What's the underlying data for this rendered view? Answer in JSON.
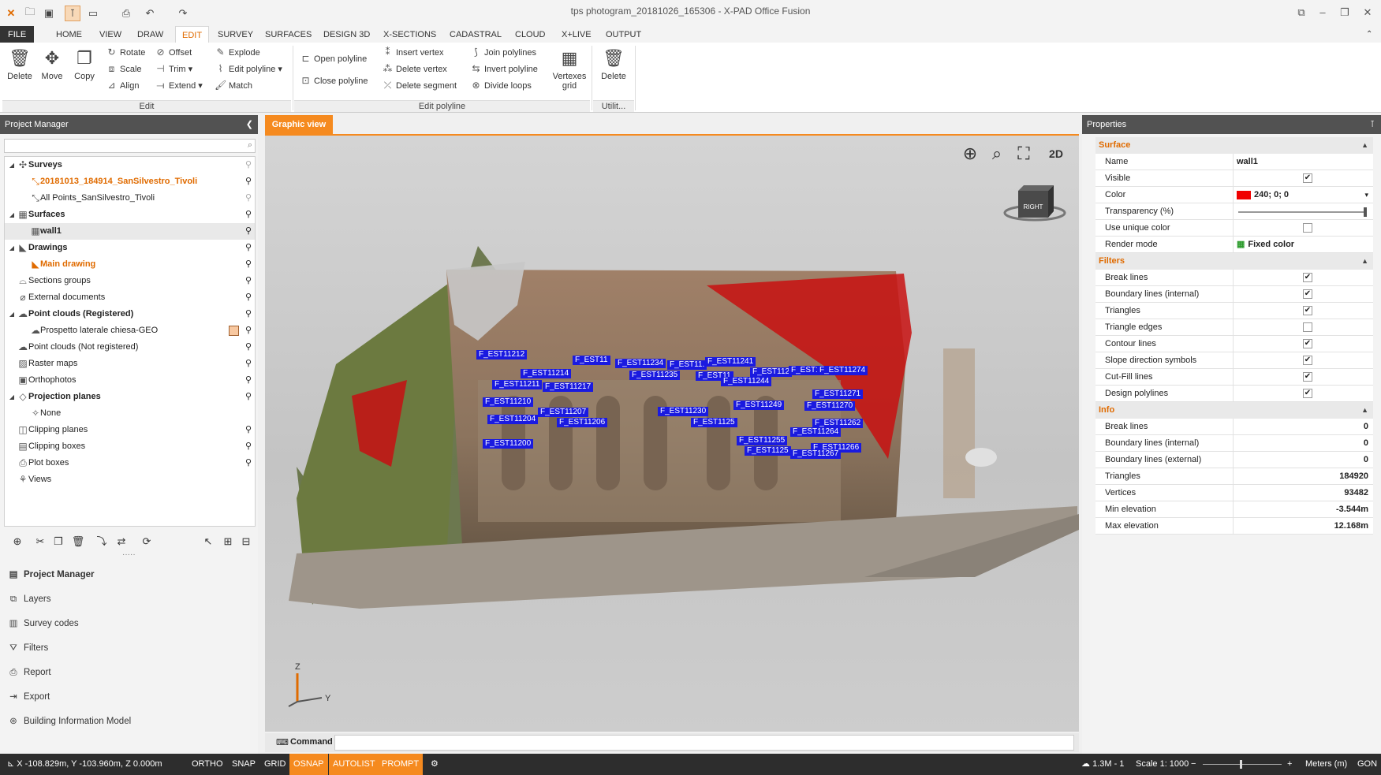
{
  "window": {
    "title": "tps photogram_20181026_165306 - X-PAD Office Fusion"
  },
  "colors": {
    "accent": "#f58a1f",
    "label_blue": "#1a1ae0",
    "surface_color": "#f00000"
  },
  "menu": {
    "tabs": [
      "FILE",
      "HOME",
      "VIEW",
      "DRAW",
      "EDIT",
      "SURVEY",
      "SURFACES",
      "DESIGN 3D",
      "X-SECTIONS",
      "CADASTRAL",
      "CLOUD",
      "X+LIVE",
      "OUTPUT"
    ],
    "active": "EDIT"
  },
  "ribbon": {
    "edit": {
      "delete": "Delete",
      "move": "Move",
      "copy": "Copy",
      "rotate": "Rotate",
      "scale": "Scale",
      "align": "Align",
      "offset": "Offset",
      "trim": "Trim",
      "extend": "Extend",
      "explode": "Explode",
      "edit_polyline": "Edit polyline",
      "match": "Match",
      "group": "Edit"
    },
    "polyline": {
      "open": "Open polyline",
      "close": "Close polyline",
      "insert_vertex": "Insert vertex",
      "delete_vertex": "Delete vertex",
      "delete_segment": "Delete segment",
      "join": "Join polylines",
      "invert": "Invert polyline",
      "divide": "Divide loops",
      "vertexes_grid_1": "Vertexes",
      "vertexes_grid_2": "grid",
      "group": "Edit polyline"
    },
    "util": {
      "delete": "Delete",
      "group": "Utilit..."
    }
  },
  "project_manager": {
    "title": "Project Manager",
    "tree": [
      {
        "label": "Surveys",
        "icon": "survey-icon",
        "level": 0,
        "bold": true
      },
      {
        "label": "20181013_184914_SanSilvestro_Tivoli",
        "icon": "survey-item-icon",
        "level": 1,
        "active": true
      },
      {
        "label": "All Points_SanSilvestro_Tivoli",
        "icon": "points-icon",
        "level": 1
      },
      {
        "label": "Surfaces",
        "icon": "surface-icon",
        "level": 0,
        "bold": true
      },
      {
        "label": "wall1",
        "icon": "surface-item-icon",
        "level": 1,
        "bold": true,
        "selected": true
      },
      {
        "label": "Drawings",
        "icon": "drawing-icon",
        "level": 0,
        "bold": true
      },
      {
        "label": "Main drawing",
        "icon": "drawing-item-icon",
        "level": 1,
        "active": true
      },
      {
        "label": "Sections groups",
        "icon": "sections-icon",
        "level": 0
      },
      {
        "label": "External documents",
        "icon": "attachment-icon",
        "level": 0
      },
      {
        "label": "Point clouds (Registered)",
        "icon": "cloud-icon",
        "level": 0,
        "bold": true
      },
      {
        "label": "Prospetto laterale chiesa-GEO",
        "icon": "cloud-item-icon",
        "level": 1
      },
      {
        "label": "Point clouds (Not registered)",
        "icon": "cloud-icon",
        "level": 0
      },
      {
        "label": "Raster maps",
        "icon": "raster-icon",
        "level": 0
      },
      {
        "label": "Orthophotos",
        "icon": "ortho-icon",
        "level": 0
      },
      {
        "label": "Projection planes",
        "icon": "plane-icon",
        "level": 0,
        "bold": true
      },
      {
        "label": "None",
        "icon": "none-icon",
        "level": 1
      },
      {
        "label": "Clipping planes",
        "icon": "clip-plane-icon",
        "level": 0
      },
      {
        "label": "Clipping boxes",
        "icon": "clip-box-icon",
        "level": 0
      },
      {
        "label": "Plot boxes",
        "icon": "plot-box-icon",
        "level": 0
      },
      {
        "label": "Views",
        "icon": "views-icon",
        "level": 0
      }
    ],
    "nav": [
      "Project Manager",
      "Layers",
      "Survey codes",
      "Filters",
      "Report",
      "Export",
      "Building Information Model"
    ]
  },
  "graphic_view": {
    "tab": "Graphic view",
    "cube_label": "RIGHT",
    "view_2d": "2D",
    "axis_z": "Z",
    "axis_y": "Y",
    "labels": [
      "F_EST11212",
      "F_EST11",
      "F_EST11234",
      "F_EST11.",
      "F_EST11241",
      "F_EST11214",
      "F_EST11235",
      "F_EST11",
      "F_EST112",
      "F_EST1",
      "F_EST11274",
      "F_EST11211",
      "F_EST11217",
      "F_EST11244",
      "F_EST11210",
      "F_EST11207",
      "F_EST11230",
      "F_EST11249",
      "F_EST11270",
      "F_EST11271",
      "F_EST11204",
      "F_EST11206",
      "F_EST1125",
      "F_EST11262",
      "F_EST11264",
      "F_EST11200",
      "F_EST11255",
      "F_EST11266",
      "F_EST11267",
      "F_EST1125"
    ]
  },
  "command": {
    "label": "Command"
  },
  "properties": {
    "title": "Properties",
    "surface": {
      "section": "Surface",
      "name_k": "Name",
      "name_v": "wall1",
      "visible_k": "Visible",
      "color_k": "Color",
      "color_v": "240; 0; 0",
      "transp_k": "Transparency (%)",
      "unique_k": "Use unique color",
      "render_k": "Render mode",
      "render_v": "Fixed color"
    },
    "filters": {
      "section": "Filters",
      "rows": [
        {
          "k": "Break lines",
          "checked": true
        },
        {
          "k": "Boundary lines (internal)",
          "checked": true
        },
        {
          "k": "Triangles",
          "checked": true
        },
        {
          "k": "Triangle edges",
          "checked": false
        },
        {
          "k": "Contour lines",
          "checked": true
        },
        {
          "k": "Slope direction symbols",
          "checked": true
        },
        {
          "k": "Cut-Fill lines",
          "checked": true
        },
        {
          "k": "Design polylines",
          "checked": true
        }
      ]
    },
    "info": {
      "section": "Info",
      "rows": [
        {
          "k": "Break lines",
          "v": "0"
        },
        {
          "k": "Boundary lines (internal)",
          "v": "0"
        },
        {
          "k": "Boundary lines (external)",
          "v": "0"
        },
        {
          "k": "Triangles",
          "v": "184920"
        },
        {
          "k": "Vertices",
          "v": "93482"
        },
        {
          "k": "Min elevation",
          "v": "-3.544m"
        },
        {
          "k": "Max elevation",
          "v": "12.168m"
        }
      ]
    }
  },
  "status": {
    "coords": "X -108.829m, Y -103.960m, Z 0.000m",
    "ortho": "ORTHO",
    "snap": "SNAP",
    "grid": "GRID",
    "osnap": "OSNAP",
    "autolist": "AUTOLIST",
    "prompt": "PROMPT",
    "cloud": "1.3M - 1",
    "scale": "Scale 1: 1000",
    "units": "Meters (m)",
    "angle": "GON"
  }
}
